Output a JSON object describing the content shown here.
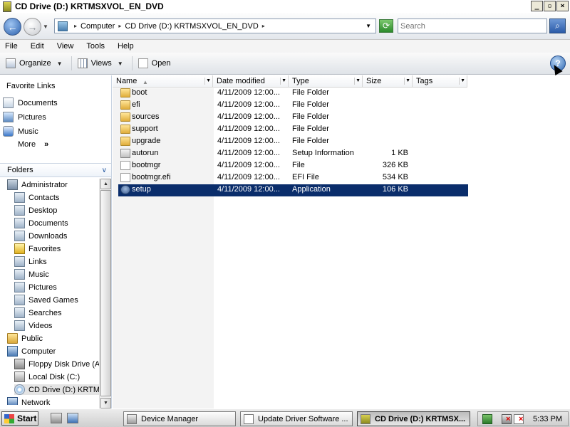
{
  "window": {
    "title": "CD Drive (D:) KRTMSXVOL_EN_DVD",
    "controls": {
      "minimize": "_",
      "maximize": "▫",
      "close": "×"
    }
  },
  "address": {
    "breadcrumbs": [
      "Computer",
      "CD Drive (D:) KRTMSXVOL_EN_DVD"
    ],
    "search_placeholder": "Search"
  },
  "menu": [
    "File",
    "Edit",
    "View",
    "Tools",
    "Help"
  ],
  "toolbar": {
    "organize": "Organize",
    "views": "Views",
    "open": "Open"
  },
  "nav": {
    "favorite_links_header": "Favorite Links",
    "favorites": [
      {
        "label": "Documents",
        "icon": "documents-icon"
      },
      {
        "label": "Pictures",
        "icon": "pictures-icon"
      },
      {
        "label": "Music",
        "icon": "music-icon"
      }
    ],
    "more": "More",
    "more_chevron": "»",
    "folders_header": "Folders",
    "folders_chevron": "∨",
    "tree": [
      {
        "label": "Administrator",
        "level": 1,
        "icon": "user-icon"
      },
      {
        "label": "Contacts",
        "level": 2,
        "icon": "library-icon"
      },
      {
        "label": "Desktop",
        "level": 2,
        "icon": "library-icon"
      },
      {
        "label": "Documents",
        "level": 2,
        "icon": "library-icon"
      },
      {
        "label": "Downloads",
        "level": 2,
        "icon": "library-icon"
      },
      {
        "label": "Favorites",
        "level": 2,
        "icon": "star-icon"
      },
      {
        "label": "Links",
        "level": 2,
        "icon": "library-icon"
      },
      {
        "label": "Music",
        "level": 2,
        "icon": "library-icon"
      },
      {
        "label": "Pictures",
        "level": 2,
        "icon": "library-icon"
      },
      {
        "label": "Saved Games",
        "level": 2,
        "icon": "library-icon"
      },
      {
        "label": "Searches",
        "level": 2,
        "icon": "library-icon"
      },
      {
        "label": "Videos",
        "level": 2,
        "icon": "library-icon"
      },
      {
        "label": "Public",
        "level": 1,
        "icon": "folder-icon"
      },
      {
        "label": "Computer",
        "level": 1,
        "icon": "computer-icon"
      },
      {
        "label": "Floppy Disk Drive (A:",
        "level": 2,
        "icon": "floppy-icon"
      },
      {
        "label": "Local Disk (C:)",
        "level": 2,
        "icon": "disk-icon"
      },
      {
        "label": "CD Drive (D:) KRTMS",
        "level": 2,
        "icon": "cd-icon",
        "selected": true
      },
      {
        "label": "Network",
        "level": 1,
        "icon": "network-icon"
      }
    ]
  },
  "columns": [
    "Name",
    "Date modified",
    "Type",
    "Size",
    "Tags"
  ],
  "files": [
    {
      "name": "boot",
      "date": "4/11/2009 12:00...",
      "type": "File Folder",
      "size": "",
      "icon": "folder-icon"
    },
    {
      "name": "efi",
      "date": "4/11/2009 12:00...",
      "type": "File Folder",
      "size": "",
      "icon": "folder-icon"
    },
    {
      "name": "sources",
      "date": "4/11/2009 12:00...",
      "type": "File Folder",
      "size": "",
      "icon": "folder-icon"
    },
    {
      "name": "support",
      "date": "4/11/2009 12:00...",
      "type": "File Folder",
      "size": "",
      "icon": "folder-icon"
    },
    {
      "name": "upgrade",
      "date": "4/11/2009 12:00...",
      "type": "File Folder",
      "size": "",
      "icon": "folder-icon"
    },
    {
      "name": "autorun",
      "date": "4/11/2009 12:00...",
      "type": "Setup Information",
      "size": "1 KB",
      "icon": "setup-info-icon"
    },
    {
      "name": "bootmgr",
      "date": "4/11/2009 12:00...",
      "type": "File",
      "size": "326 KB",
      "icon": "file-icon"
    },
    {
      "name": "bootmgr.efi",
      "date": "4/11/2009 12:00...",
      "type": "EFI File",
      "size": "534 KB",
      "icon": "file-icon"
    },
    {
      "name": "setup",
      "date": "4/11/2009 12:00...",
      "type": "Application",
      "size": "106 KB",
      "icon": "application-icon",
      "selected": true
    }
  ],
  "taskbar": {
    "start": "Start",
    "tasks": [
      {
        "label": "Device Manager",
        "icon": "device-manager-icon"
      },
      {
        "label": "Update Driver Software ...",
        "icon": "update-driver-icon"
      },
      {
        "label": "CD Drive (D:) KRTMSX...",
        "icon": "cd-drive-icon",
        "active": true
      }
    ],
    "clock": "5:33 PM"
  },
  "colors": {
    "selection": "#0a2d6b",
    "accent": "#2b60ad"
  }
}
